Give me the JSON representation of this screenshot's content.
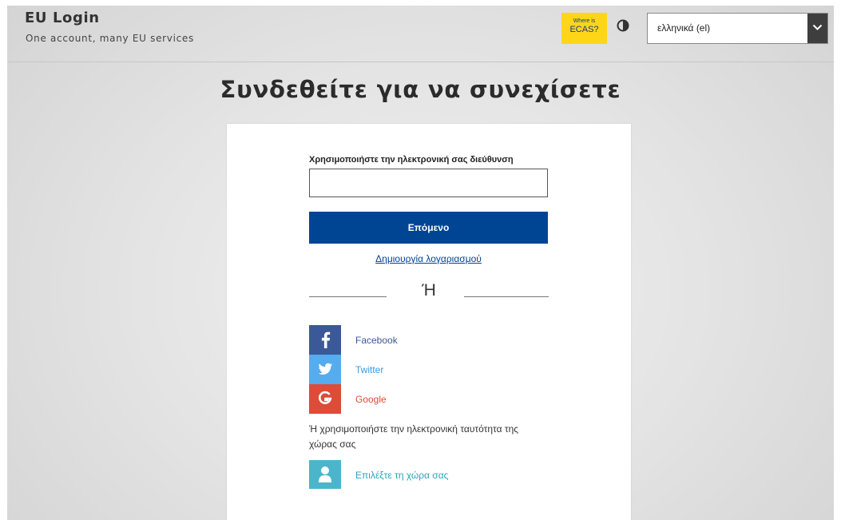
{
  "header": {
    "title": "EU Login",
    "subtitle": "One account, many EU services",
    "ecas_line1": "Where is",
    "ecas_line2": "ECAS?",
    "language": "ελληνικά (el)"
  },
  "main": {
    "title": "Συνδεθείτε για να συνεχίσετε",
    "email_label": "Χρησιμοποιήστε την ηλεκτρονική σας διεύθυνση",
    "email_value": "",
    "next_label": "Επόμενο",
    "create_account": "Δημιουργία λογαριασμού",
    "or_text": "Ή",
    "social": [
      {
        "label": "Facebook",
        "icon": "facebook-icon",
        "color": "#3b5998"
      },
      {
        "label": "Twitter",
        "icon": "twitter-icon",
        "color": "#55acee"
      },
      {
        "label": "Google",
        "icon": "google-icon",
        "color": "#dd4b39"
      }
    ],
    "eid_text": "Ή χρησιμοποιήστε την ηλεκτρονική ταυτότητα της χώρας σας",
    "country_label": "Επιλέξτε τη χώρα σας"
  },
  "colors": {
    "primary": "#004494",
    "ecas_yellow": "#ffd617",
    "country_teal": "#4bb6c9"
  }
}
